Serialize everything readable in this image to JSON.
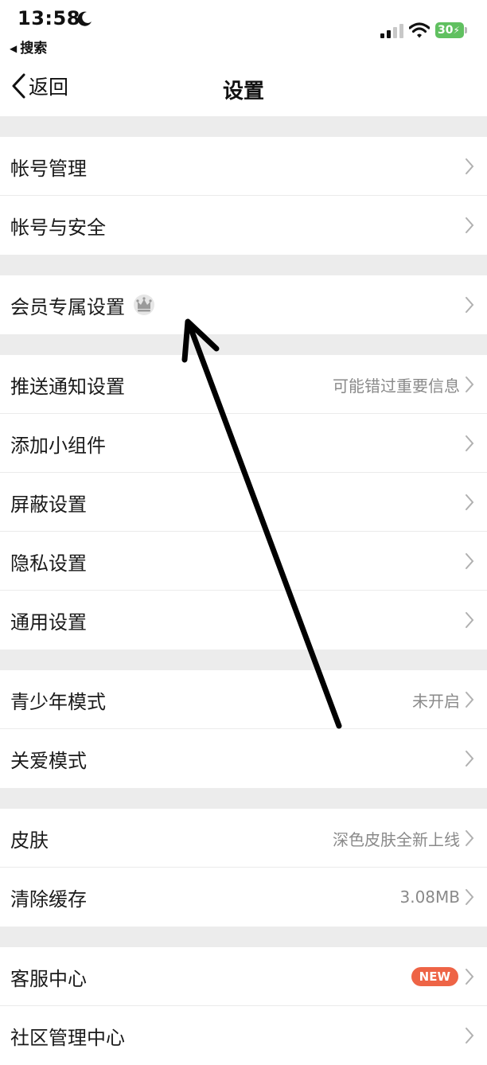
{
  "status_bar": {
    "time": "13:58",
    "back_app": "搜索",
    "battery": "30",
    "battery_color": "#60c060"
  },
  "nav": {
    "back_label": "返回",
    "title": "设置"
  },
  "groups": [
    [
      {
        "label": "帐号管理"
      },
      {
        "label": "帐号与安全"
      }
    ],
    [
      {
        "label": "会员专属设置",
        "icon": "crown-icon"
      }
    ],
    [
      {
        "label": "推送通知设置",
        "value": "可能错过重要信息"
      },
      {
        "label": "添加小组件"
      },
      {
        "label": "屏蔽设置"
      },
      {
        "label": "隐私设置"
      },
      {
        "label": "通用设置"
      }
    ],
    [
      {
        "label": "青少年模式",
        "value": "未开启"
      },
      {
        "label": "关爱模式"
      }
    ],
    [
      {
        "label": "皮肤",
        "value": "深色皮肤全新上线"
      },
      {
        "label": "清除缓存",
        "value": "3.08MB"
      }
    ],
    [
      {
        "label": "客服中心",
        "badge": "NEW",
        "badge_color": "#ee6446"
      },
      {
        "label": "社区管理中心"
      }
    ]
  ],
  "annotation": {
    "icon": "arrow-annotation",
    "color": "#000000"
  }
}
